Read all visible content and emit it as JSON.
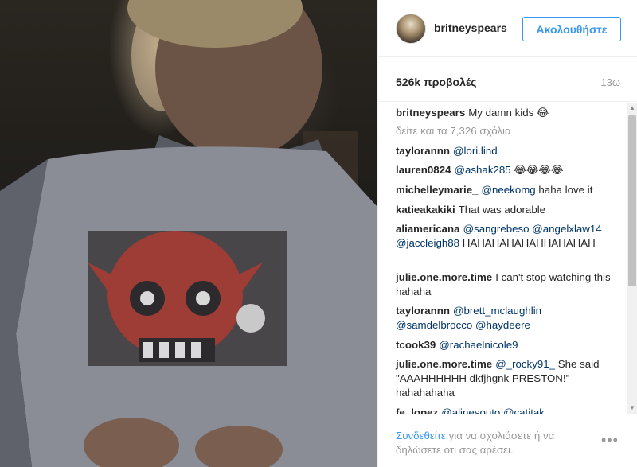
{
  "post": {
    "username": "britneyspears",
    "follow_label": "Ακολουθήστε",
    "views": "526k προβολές",
    "age": "13ω"
  },
  "caption": {
    "user": "britneyspears",
    "text": "My damn kids 😂"
  },
  "more_comments": "δείτε και τα 7,326 σχόλια",
  "comments": [
    {
      "user": "taylorannn",
      "mentions": "@lori.lind",
      "text": ""
    },
    {
      "user": "lauren0824",
      "mentions": "@ashak285",
      "text": "😂😂😂😂"
    },
    {
      "user": "michelleymarie_",
      "mentions": "@neekomg",
      "text": "haha love it"
    },
    {
      "user": "katieakakiki",
      "mentions": "",
      "text": "That was adorable"
    },
    {
      "user": "aliamericana",
      "mentions": "@sangrebeso @angelxlaw14 @jaccleigh88",
      "text": "HAHAHAHAHAHHAHAHAH"
    },
    {
      "user": "julie.one.more.time",
      "mentions": "",
      "text": "I can't stop watching this hahaha"
    },
    {
      "user": "taylorannn",
      "mentions": "@brett_mclaughlin @samdelbrocco @haydeere",
      "text": ""
    },
    {
      "user": "tcook39",
      "mentions": "@rachaelnicole9",
      "text": ""
    },
    {
      "user": "julie.one.more.time",
      "mentions": "@_rocky91_",
      "text": "She said \"AAAHHHHHH dkfjhgnk PRESTON!\" hahahahaha"
    },
    {
      "user": "fe_lopez",
      "mentions": "@alinesouto @catitak",
      "text": ""
    }
  ],
  "footer": {
    "login_link": "Συνδεθείτε",
    "login_rest": "για να σχολιάσετε ή να δηλώσετε ότι σας αρέσει.",
    "more_icon": "•••"
  },
  "icons": {
    "scroll_up": "▲",
    "scroll_down": "▼"
  },
  "colors": {
    "accent": "#3897f0",
    "mention": "#003569",
    "muted": "#999999"
  }
}
